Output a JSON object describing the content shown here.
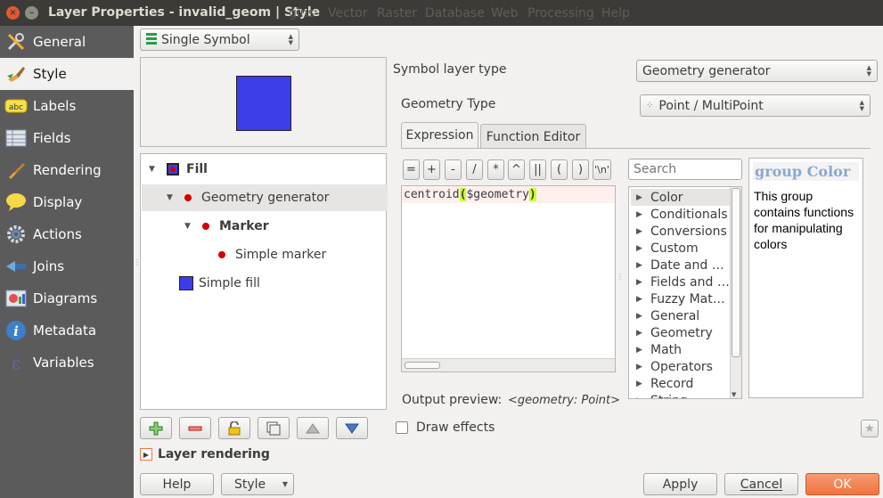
{
  "window": {
    "title": "Layer Properties - invalid_geom | Style",
    "close_glyph": "×",
    "minimize_glyph": "–",
    "background_menu": [
      "gins",
      "Vector",
      "Raster",
      "Database",
      "Web",
      "Processing",
      "Help"
    ]
  },
  "sidebar": {
    "items": [
      {
        "label": "General",
        "icon": "wrench-screwdriver-icon"
      },
      {
        "label": "Style",
        "icon": "paintbrush-icon",
        "selected": true
      },
      {
        "label": "Labels",
        "icon": "abc-label-icon"
      },
      {
        "label": "Fields",
        "icon": "table-fields-icon"
      },
      {
        "label": "Rendering",
        "icon": "brush-rendering-icon"
      },
      {
        "label": "Display",
        "icon": "speech-bubble-icon"
      },
      {
        "label": "Actions",
        "icon": "gear-actions-icon"
      },
      {
        "label": "Joins",
        "icon": "joins-icon"
      },
      {
        "label": "Diagrams",
        "icon": "diagram-icon"
      },
      {
        "label": "Metadata",
        "icon": "info-icon"
      },
      {
        "label": "Variables",
        "icon": "epsilon-icon"
      }
    ]
  },
  "renderer": {
    "selected": "Single Symbol"
  },
  "preview": {
    "fill_color": "#3d3de8"
  },
  "symbol_tree": [
    {
      "label": "Fill",
      "icon": "fill-symbol-icon",
      "bold": true,
      "level": 0
    },
    {
      "label": "Geometry generator",
      "icon": "red-dot-icon",
      "bold": false,
      "level": 1,
      "selected": true
    },
    {
      "label": "Marker",
      "icon": "red-dot-icon",
      "bold": true,
      "level": 2
    },
    {
      "label": "Simple marker",
      "icon": "red-dot-icon",
      "bold": false,
      "level": 3
    },
    {
      "label": "Simple fill",
      "icon": "blue-square-icon",
      "bold": false,
      "level": 1
    }
  ],
  "layer_rendering": {
    "label": "Layer rendering"
  },
  "symbol_layer": {
    "type_label": "Symbol layer type",
    "type_value": "Geometry generator",
    "geometry_type_label": "Geometry Type",
    "geometry_type_value": "Point / MultiPoint"
  },
  "tabs": [
    {
      "label": "Expression",
      "active": true
    },
    {
      "label": "Function Editor",
      "active": false
    }
  ],
  "operators": [
    "=",
    "+",
    "-",
    "/",
    "*",
    "^",
    "||",
    "(",
    ")",
    "'\\n'"
  ],
  "expression": {
    "func": "centroid",
    "open_paren": "(",
    "var_prefix": "$",
    "var_name": "geometry",
    "close_paren": ")"
  },
  "output_preview": {
    "label": "Output preview:",
    "value": "<geometry: Point>"
  },
  "search": {
    "placeholder": "Search"
  },
  "function_groups": [
    "Color",
    "Conditionals",
    "Conversions",
    "Custom",
    "Date and …",
    "Fields and …",
    "Fuzzy Mat…",
    "General",
    "Geometry",
    "Math",
    "Operators",
    "Record",
    "String"
  ],
  "help_panel": {
    "title": "group Color",
    "body": "This group contains functions for manipulating colors"
  },
  "draw_effects": {
    "label": "Draw effects",
    "checked": false
  },
  "footer": {
    "help": "Help",
    "style": "Style",
    "apply": "Apply",
    "cancel": "Cancel",
    "ok": "OK"
  },
  "colors": {
    "accent": "#f07746",
    "sidebar_bg": "#5b5b5b",
    "titlebar_bg": "#3c3b37",
    "highlight_paren": "#ccff33"
  }
}
